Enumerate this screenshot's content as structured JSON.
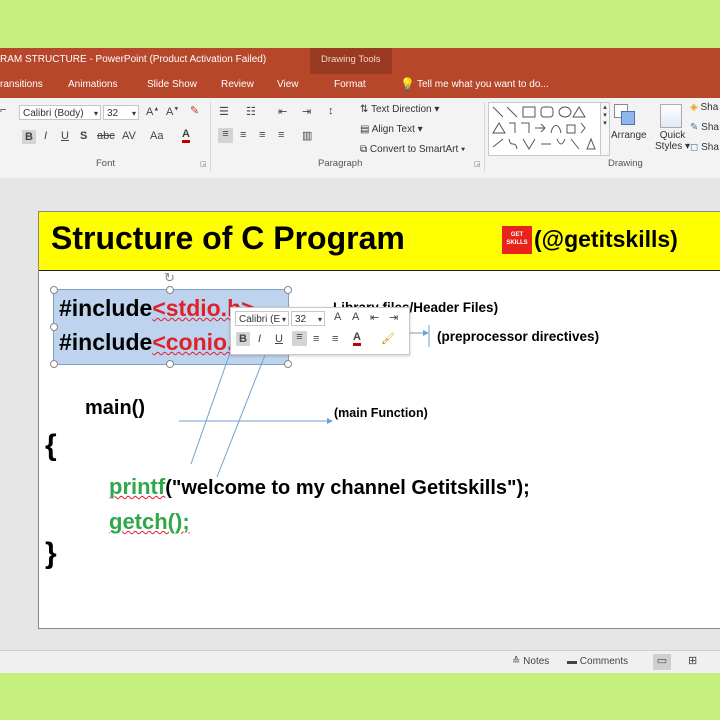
{
  "window": {
    "title": "RAM STRUCTURE - PowerPoint (Product Activation Failed)",
    "contextual_tab_group": "Drawing Tools"
  },
  "ribbon_tabs": [
    {
      "label": "ransitions"
    },
    {
      "label": "Animations"
    },
    {
      "label": "Slide Show"
    },
    {
      "label": "Review"
    },
    {
      "label": "View"
    },
    {
      "label": "Format"
    }
  ],
  "tell_me": "Tell me what you want to do...",
  "ribbon": {
    "font_name": "Calibri (Body)",
    "font_size": "32",
    "font_group": "Font",
    "paragraph_group": "Paragraph",
    "drawing_group": "Drawing",
    "text_direction": "Text Direction",
    "align_text": "Align Text",
    "convert_smartart": "Convert to SmartArt",
    "arrange": "Arrange",
    "quick_styles_1": "Quick",
    "quick_styles_2": "Styles",
    "shape_fill": "Sha",
    "shape_outline": "Sha",
    "shape_effects": "Sha"
  },
  "slide": {
    "title": "Structure of C Program",
    "logo_text": "GET SKILLS",
    "handle": "(@getitskills)",
    "include_kw_1": "#include",
    "include_hdr_1": "<stdio.h>",
    "include_kw_2": "#include",
    "include_hdr_2": "<conio.h>",
    "main": "main()",
    "open_brace": "{",
    "printf_fn": "printf",
    "printf_args": "(\"welcome to my channel Getitskills\");",
    "getch": "getch();",
    "close_brace": "}",
    "note_library": "Library files/Header Files)",
    "note_preprocessor": "(preprocessor directives)",
    "note_main": "(main Function)"
  },
  "mini_toolbar": {
    "font_name": "Calibri (E",
    "font_size": "32"
  },
  "statusbar": {
    "notes": "Notes",
    "comments": "Comments"
  }
}
